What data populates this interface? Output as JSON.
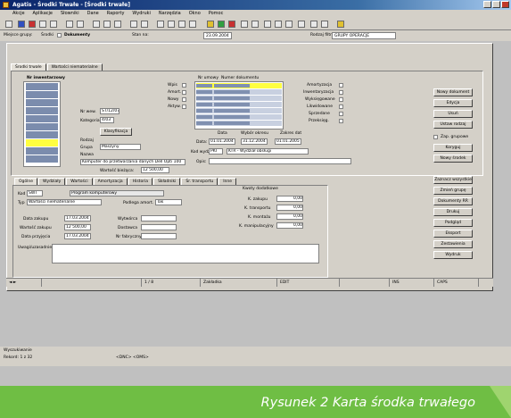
{
  "window": {
    "title": "Agatis - Środki Trwałe - [Środki trwałe]",
    "menu": [
      "Akcje",
      "Aplikacje",
      "Słowniki",
      "Dane",
      "Raporty",
      "Wydruki",
      "Narzędzia",
      "Okno",
      "Pomoc"
    ]
  },
  "filter": {
    "label1": "Miejsce grupy:",
    "value1": "Środki",
    "label2": "Dokumenty",
    "label3": "Stan na:",
    "date": "23.09.2004",
    "label4": "Rodzaj filtra:",
    "combo": "GRUPY OPERACJE"
  },
  "tabs_top": [
    "Środki trwałe",
    "Wartości niematerialne"
  ],
  "left": {
    "header": "Nr inwentarzowy",
    "nr_label": "Nr wew.",
    "nr_value": "ŚT/12/07",
    "kat_label": "Kategoria:",
    "kat_value": "4/03",
    "klas_button": "Klasyfikacja",
    "rodzaj_label": "Rodzaj",
    "grupa_label": "Grupa",
    "grupa_value": "Maszyny",
    "nazwa_label": "Nazwa",
    "nazwa_value": "Komputer do przetwarzania danych Dell Opti 100",
    "wart_label": "Wartość bieżąca:",
    "wart_value": "12 500,00",
    "umorz_label": "Wartość umorz.:",
    "umorz_value": "8 750,00"
  },
  "checks": [
    "Wpis",
    "Amort.",
    "Nowy",
    "Aktyw."
  ],
  "docs": {
    "col1": "Nr umowy",
    "col2": "Numer dokumentu",
    "data_label": "Data:",
    "data1": "01.01.2004",
    "data2": "31.12.2004",
    "data3": "01.01.2005",
    "kod_label": "Kod wydz.:",
    "kod_value": "PKT",
    "kod_desc": "KTR - Wydział obsługi",
    "opis_label": "Opis:",
    "radio_label": "Data",
    "radio_label2": "Wybór okresu",
    "radio_label3": "Zakres dat"
  },
  "options": [
    "Amortyzacja",
    "Inwentaryzacja",
    "Wyksięgowane",
    "Likwidowane",
    "Sprzedane",
    "Przeksięg."
  ],
  "right_buttons": [
    "Nowy dokument",
    "Edycja",
    "Usuń",
    "Ustaw rodzaj",
    "Koryguj",
    "Nowy środek",
    "Zaznacz wszystkie",
    "Zmień grupę",
    "Dokumenty RR",
    "Drukuj",
    "Podgląd",
    "Eksport",
    "Zestawienia",
    "Wydruk"
  ],
  "right_check": "Zap. grupowe",
  "lower_tabs": [
    "Ogólne",
    "Wydziały",
    "Wartości",
    "Amortyzacja",
    "Historia",
    "Składniki",
    "Śr. transportu",
    "Inne"
  ],
  "lower": {
    "kod_label": "Kod",
    "kod_value": "SWT",
    "kod_desc": "Program komputerowy",
    "typ_label": "Typ",
    "typ_value": "Wartości niematerialne",
    "podl_label": "Podlega amort.",
    "podl_value": "Tak",
    "data_zak_label": "Data zakupu",
    "data_zak_value": "17.03.2004",
    "wart_zak_label": "Wartość zakupu",
    "wart_zak_value": "12 500,00",
    "data_przy_label": "Data przyjęcia",
    "data_przy_value": "17.03.2004",
    "wytw_label": "Wytwórca",
    "dostawca_label": "Dostawca",
    "nr_fab_label": "Nr fabryczny",
    "uwagi_label": "Uwagi/uzasadnienie",
    "kwoty_label": "Kwoty dodatkowe",
    "k1": "K. zakupu",
    "k2": "K. transportu",
    "k3": "K. montażu",
    "k4": "K. manipulacyjny",
    "k_vals": [
      "0,00",
      "0,00",
      "0,00",
      "0,00"
    ]
  },
  "statusbar": [
    "1 / 8",
    "Zakładka",
    "EDIT",
    "",
    "INS",
    "CAPS"
  ],
  "appstatus": {
    "line1": "Wyszukiwanie",
    "line2": "Rekord: 1 z 32",
    "line3": "<DNC> <OMS>"
  },
  "caption": "Rysunek 2 Karta środka trwałego",
  "colors": {
    "caption_band": "#6fbe44",
    "titlebar": "#0a246a",
    "selection": "#ffff40"
  }
}
